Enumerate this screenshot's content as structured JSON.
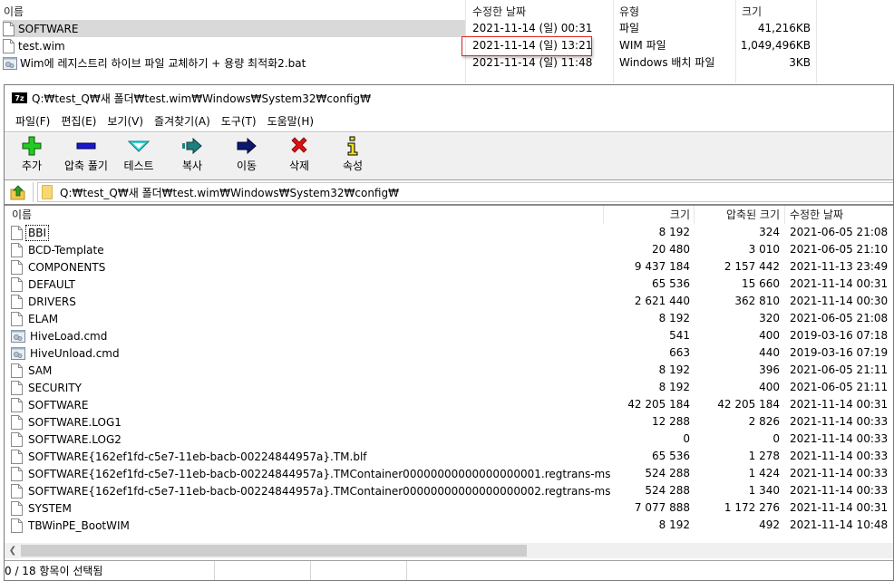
{
  "explorer": {
    "columns": {
      "name": "이름",
      "modified": "수정한 날짜",
      "type": "유형",
      "size": "크기"
    },
    "files": [
      {
        "name": "SOFTWARE",
        "modified": "2021-11-14 (일) 00:31",
        "type": "파일",
        "size": "41,216KB",
        "icon": "file-icon",
        "selected": true
      },
      {
        "name": "test.wim",
        "modified": "2021-11-14 (일) 13:21",
        "type": "WIM 파일",
        "size": "1,049,496KB",
        "icon": "file-icon",
        "highlighted_date": true
      },
      {
        "name": "Wim에 레지스트리 하이브 파일 교체하기 + 용량 최적화2.bat",
        "modified": "2021-11-14 (일) 11:48",
        "type": "Windows 배치 파일",
        "size": "3KB",
        "icon": "batch-file-icon"
      }
    ]
  },
  "sevenzip": {
    "title": "Q:₩test_Q₩새 폴더₩test.wim₩Windows₩System32₩config₩",
    "logo": "7z",
    "menu": [
      {
        "label": "파일(F)"
      },
      {
        "label": "편집(E)"
      },
      {
        "label": "보기(V)"
      },
      {
        "label": "즐겨찾기(A)"
      },
      {
        "label": "도구(T)"
      },
      {
        "label": "도움말(H)"
      }
    ],
    "toolbar": [
      {
        "id": "add",
        "label": "추가",
        "icon": "plus-icon",
        "color": "#22cc22"
      },
      {
        "id": "extract",
        "label": "압축 풀기",
        "icon": "minus-icon",
        "color": "#1a1acc"
      },
      {
        "id": "test",
        "label": "테스트",
        "icon": "check-chevron-icon",
        "color": "#33e0e0"
      },
      {
        "id": "copy",
        "label": "복사",
        "icon": "copy-arrow-icon",
        "color": "#1f7f7f"
      },
      {
        "id": "move",
        "label": "이동",
        "icon": "move-arrow-icon",
        "color": "#0b1a6e"
      },
      {
        "id": "delete",
        "label": "삭제",
        "icon": "delete-x-icon",
        "color": "#e01010"
      },
      {
        "id": "info",
        "label": "속성",
        "icon": "info-icon",
        "color": "#f0e020"
      }
    ],
    "address": "Q:₩test_Q₩새 폴더₩test.wim₩Windows₩System32₩config₩",
    "columns": {
      "name": "이름",
      "size": "크기",
      "packed": "압축된 크기",
      "modified": "수정한 날짜"
    },
    "files": [
      {
        "name": "BBI",
        "size": "8 192",
        "packed": "324",
        "modified": "2021-06-05 21:08",
        "icon": "file-icon",
        "focused": true
      },
      {
        "name": "BCD-Template",
        "size": "20 480",
        "packed": "3 010",
        "modified": "2021-06-05 21:10",
        "icon": "file-icon"
      },
      {
        "name": "COMPONENTS",
        "size": "9 437 184",
        "packed": "2 157 442",
        "modified": "2021-11-13 23:49",
        "icon": "file-icon"
      },
      {
        "name": "DEFAULT",
        "size": "65 536",
        "packed": "15 660",
        "modified": "2021-11-14 00:31",
        "icon": "file-icon"
      },
      {
        "name": "DRIVERS",
        "size": "2 621 440",
        "packed": "362 810",
        "modified": "2021-11-14 00:30",
        "icon": "file-icon"
      },
      {
        "name": "ELAM",
        "size": "8 192",
        "packed": "320",
        "modified": "2021-06-05 21:08",
        "icon": "file-icon"
      },
      {
        "name": "HiveLoad.cmd",
        "size": "541",
        "packed": "400",
        "modified": "2019-03-16 07:18",
        "icon": "batch-file-icon"
      },
      {
        "name": "HiveUnload.cmd",
        "size": "663",
        "packed": "440",
        "modified": "2019-03-16 07:19",
        "icon": "batch-file-icon"
      },
      {
        "name": "SAM",
        "size": "8 192",
        "packed": "396",
        "modified": "2021-06-05 21:11",
        "icon": "file-icon"
      },
      {
        "name": "SECURITY",
        "size": "8 192",
        "packed": "400",
        "modified": "2021-06-05 21:11",
        "icon": "file-icon"
      },
      {
        "name": "SOFTWARE",
        "size": "42 205 184",
        "packed": "42 205 184",
        "modified": "2021-11-14 00:31",
        "icon": "file-icon"
      },
      {
        "name": "SOFTWARE.LOG1",
        "size": "12 288",
        "packed": "2 826",
        "modified": "2021-11-14 00:33",
        "icon": "file-icon"
      },
      {
        "name": "SOFTWARE.LOG2",
        "size": "0",
        "packed": "0",
        "modified": "2021-11-14 00:33",
        "icon": "file-icon"
      },
      {
        "name": "SOFTWARE{162ef1fd-c5e7-11eb-bacb-00224844957a}.TM.blf",
        "size": "65 536",
        "packed": "1 278",
        "modified": "2021-11-14 00:33",
        "icon": "file-icon"
      },
      {
        "name": "SOFTWARE{162ef1fd-c5e7-11eb-bacb-00224844957a}.TMContainer00000000000000000001.regtrans-ms",
        "size": "524 288",
        "packed": "1 424",
        "modified": "2021-11-14 00:33",
        "icon": "file-icon"
      },
      {
        "name": "SOFTWARE{162ef1fd-c5e7-11eb-bacb-00224844957a}.TMContainer00000000000000000002.regtrans-ms",
        "size": "524 288",
        "packed": "1 340",
        "modified": "2021-11-14 00:33",
        "icon": "file-icon"
      },
      {
        "name": "SYSTEM",
        "size": "7 077 888",
        "packed": "1 172 276",
        "modified": "2021-11-14 00:31",
        "icon": "file-icon"
      },
      {
        "name": "TBWinPE_BootWIM",
        "size": "8 192",
        "packed": "492",
        "modified": "2021-11-14 10:48",
        "icon": "file-icon"
      }
    ],
    "status": {
      "selection": "0 / 18 항목이 선택됨",
      "segment2": "",
      "segment3": "",
      "segment4": ""
    }
  }
}
